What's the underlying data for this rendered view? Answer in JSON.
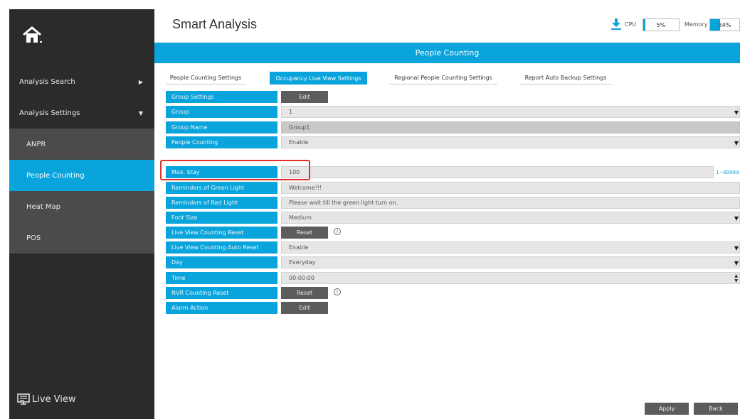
{
  "header": {
    "title": "Smart Analysis",
    "cpu_label": "CPU",
    "cpu_value": "5%",
    "cpu_fraction": 0.05,
    "memory_label": "Memory",
    "memory_value": "34%",
    "memory_fraction": 0.34
  },
  "sidebar": {
    "items": [
      {
        "label": "Analysis Search"
      },
      {
        "label": "Analysis Settings"
      }
    ],
    "subitems": [
      {
        "label": "ANPR"
      },
      {
        "label": "People Counting",
        "active": true
      },
      {
        "label": "Heat Map"
      },
      {
        "label": "POS"
      }
    ],
    "live_view": "Live View"
  },
  "banner": "People Counting",
  "tabs": [
    {
      "label": "People Counting Settings"
    },
    {
      "label": "Occupancy Live View Settings",
      "active": true
    },
    {
      "label": "Regional People Counting Settings"
    },
    {
      "label": "Report Auto Backup Settings"
    }
  ],
  "form": {
    "group_settings": {
      "label": "Group Settings",
      "button": "Edit"
    },
    "group": {
      "label": "Group",
      "value": "1"
    },
    "group_name": {
      "label": "Group Name",
      "value": "Group1"
    },
    "people_counting": {
      "label": "People Counting",
      "value": "Enable"
    },
    "max_stay": {
      "label": "Max. Stay",
      "value": "100",
      "range": "1~99999"
    },
    "green_light": {
      "label": "Reminders of Green Light",
      "value": "Welcome!!!"
    },
    "red_light": {
      "label": "Reminders of Red Light",
      "value": "Please wait till the green light turn on."
    },
    "font_size": {
      "label": "Font Size",
      "value": "Medium"
    },
    "lv_reset": {
      "label": "Live View Counting Reset",
      "button": "Reset"
    },
    "lv_auto_reset": {
      "label": "Live View Counting Auto Reset",
      "value": "Enable"
    },
    "day": {
      "label": "Day",
      "value": "Everyday"
    },
    "time": {
      "label": "Time",
      "value": "00:00:00"
    },
    "nvr_reset": {
      "label": "NVR Counting Reset",
      "button": "Reset"
    },
    "alarm_action": {
      "label": "Alarm Action",
      "button": "Edit"
    }
  },
  "footer": {
    "apply": "Apply",
    "back": "Back"
  },
  "colors": {
    "accent": "#0aa4dc",
    "sidebar_bg": "#2b2b2b",
    "highlight": "#e0322b"
  }
}
